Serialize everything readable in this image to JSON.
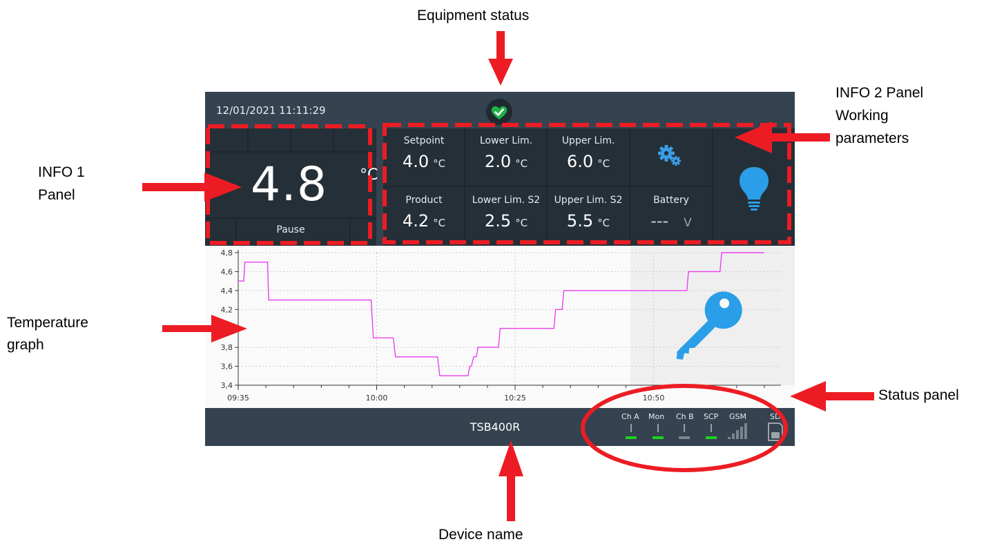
{
  "annotations": {
    "equipment_status": "Equipment status",
    "info1_line1": "INFO 1",
    "info1_line2": "Panel",
    "info2_line1": "INFO 2 Panel",
    "info2_line2": "Working",
    "info2_line3": "parameters",
    "temp_graph_line1": "Temperature",
    "temp_graph_line2": "graph",
    "status_panel": "Status panel",
    "device_name": "Device name"
  },
  "header": {
    "datetime": "12/01/2021 11:11:29",
    "status_icon": "heart-check-icon"
  },
  "info1": {
    "temperature": "4.8",
    "unit": "°C",
    "mode": "Pause"
  },
  "info2": {
    "setpoint": {
      "label": "Setpoint",
      "value": "4.0",
      "unit": "°C"
    },
    "lower_lim": {
      "label": "Lower Lim.",
      "value": "2.0",
      "unit": "°C"
    },
    "upper_lim": {
      "label": "Upper Lim.",
      "value": "6.0",
      "unit": "°C"
    },
    "product": {
      "label": "Product",
      "value": "4.2",
      "unit": "°C"
    },
    "lower_lim_s2": {
      "label": "Lower Lim. S2",
      "value": "2.5",
      "unit": "°C"
    },
    "upper_lim_s2": {
      "label": "Upper Lim. S2",
      "value": "5.5",
      "unit": "°C"
    },
    "battery": {
      "label": "Battery",
      "value": "---",
      "unit": "V"
    },
    "settings_icon": "gears-icon",
    "light_icon": "lightbulb-icon"
  },
  "footer": {
    "device_name": "TSB400R",
    "status": [
      {
        "label": "Ch A",
        "state": "on"
      },
      {
        "label": "Mon",
        "state": "on"
      },
      {
        "label": "Ch B",
        "state": "off"
      },
      {
        "label": "SCP",
        "state": "on"
      },
      {
        "label": "GSM",
        "state": "signal"
      },
      {
        "label": "SD",
        "state": "card"
      }
    ]
  },
  "colors": {
    "green": "#19d21e",
    "accent": "#2a9ee8",
    "line": "#ea3ff0",
    "annotation_red": "#ed1c24"
  },
  "chart_data": {
    "type": "line",
    "x_ticks": [
      "09:35",
      "10:00",
      "10:25",
      "10:50"
    ],
    "y_ticks": [
      "3,4",
      "3,6",
      "3,8",
      "4,2",
      "4,4",
      "4,6",
      "4,8"
    ],
    "ylim": [
      3.4,
      4.8
    ],
    "xlim_minutes": [
      0,
      98
    ],
    "x_minutes": [
      0,
      1,
      1.2,
      5.3,
      5.5,
      24,
      24.4,
      28,
      28.4,
      36,
      36.4,
      41.5,
      41.8,
      42.1,
      42.5,
      43,
      43.3,
      47,
      47.3,
      57,
      57.3,
      58.5,
      58.8,
      81,
      81.3,
      87,
      87.3,
      95
    ],
    "series": [
      {
        "values": [
          4.5,
          4.5,
          4.7,
          4.7,
          4.3,
          4.3,
          3.9,
          3.9,
          3.7,
          3.7,
          3.5,
          3.5,
          3.6,
          3.6,
          3.7,
          3.7,
          3.8,
          3.8,
          4.0,
          4.0,
          4.2,
          4.2,
          4.4,
          4.4,
          4.6,
          4.6,
          4.8,
          4.8
        ]
      }
    ],
    "grid": true
  }
}
